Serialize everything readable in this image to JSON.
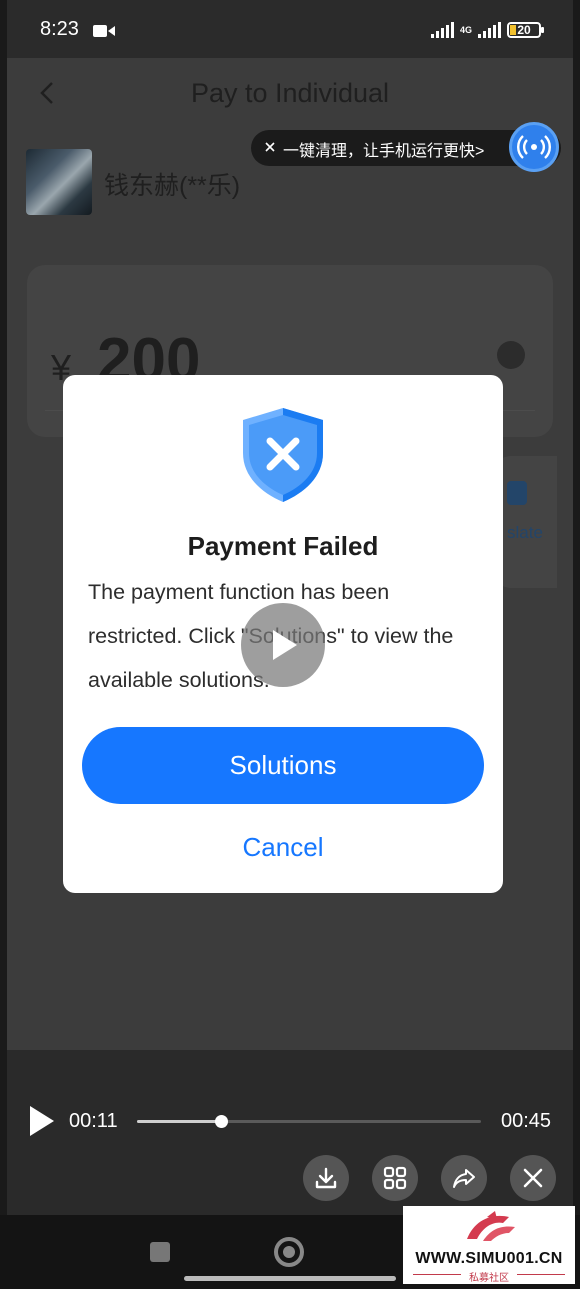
{
  "status_bar": {
    "time": "8:23",
    "network": "4G",
    "battery": "20"
  },
  "app": {
    "title": "Pay to Individual",
    "payee_name": "钱东赫(**乐)",
    "currency_symbol": "¥",
    "amount": "200",
    "translate_label": "slate"
  },
  "cleaner": {
    "text": "一键清理，让手机运行更快>"
  },
  "dialog": {
    "title": "Payment Failed",
    "body": "The payment function has been restricted. Click \"Solutions\" to view the available solutions.",
    "primary_button": "Solutions",
    "cancel_button": "Cancel"
  },
  "player": {
    "current_time": "00:11",
    "total_time": "00:45",
    "progress": 0.244
  },
  "watermark": {
    "text": "WWW.SIMU001.CN",
    "subtitle": "私募社区"
  },
  "colors": {
    "accent": "#1677ff",
    "overlay": "#3c3c3c"
  }
}
